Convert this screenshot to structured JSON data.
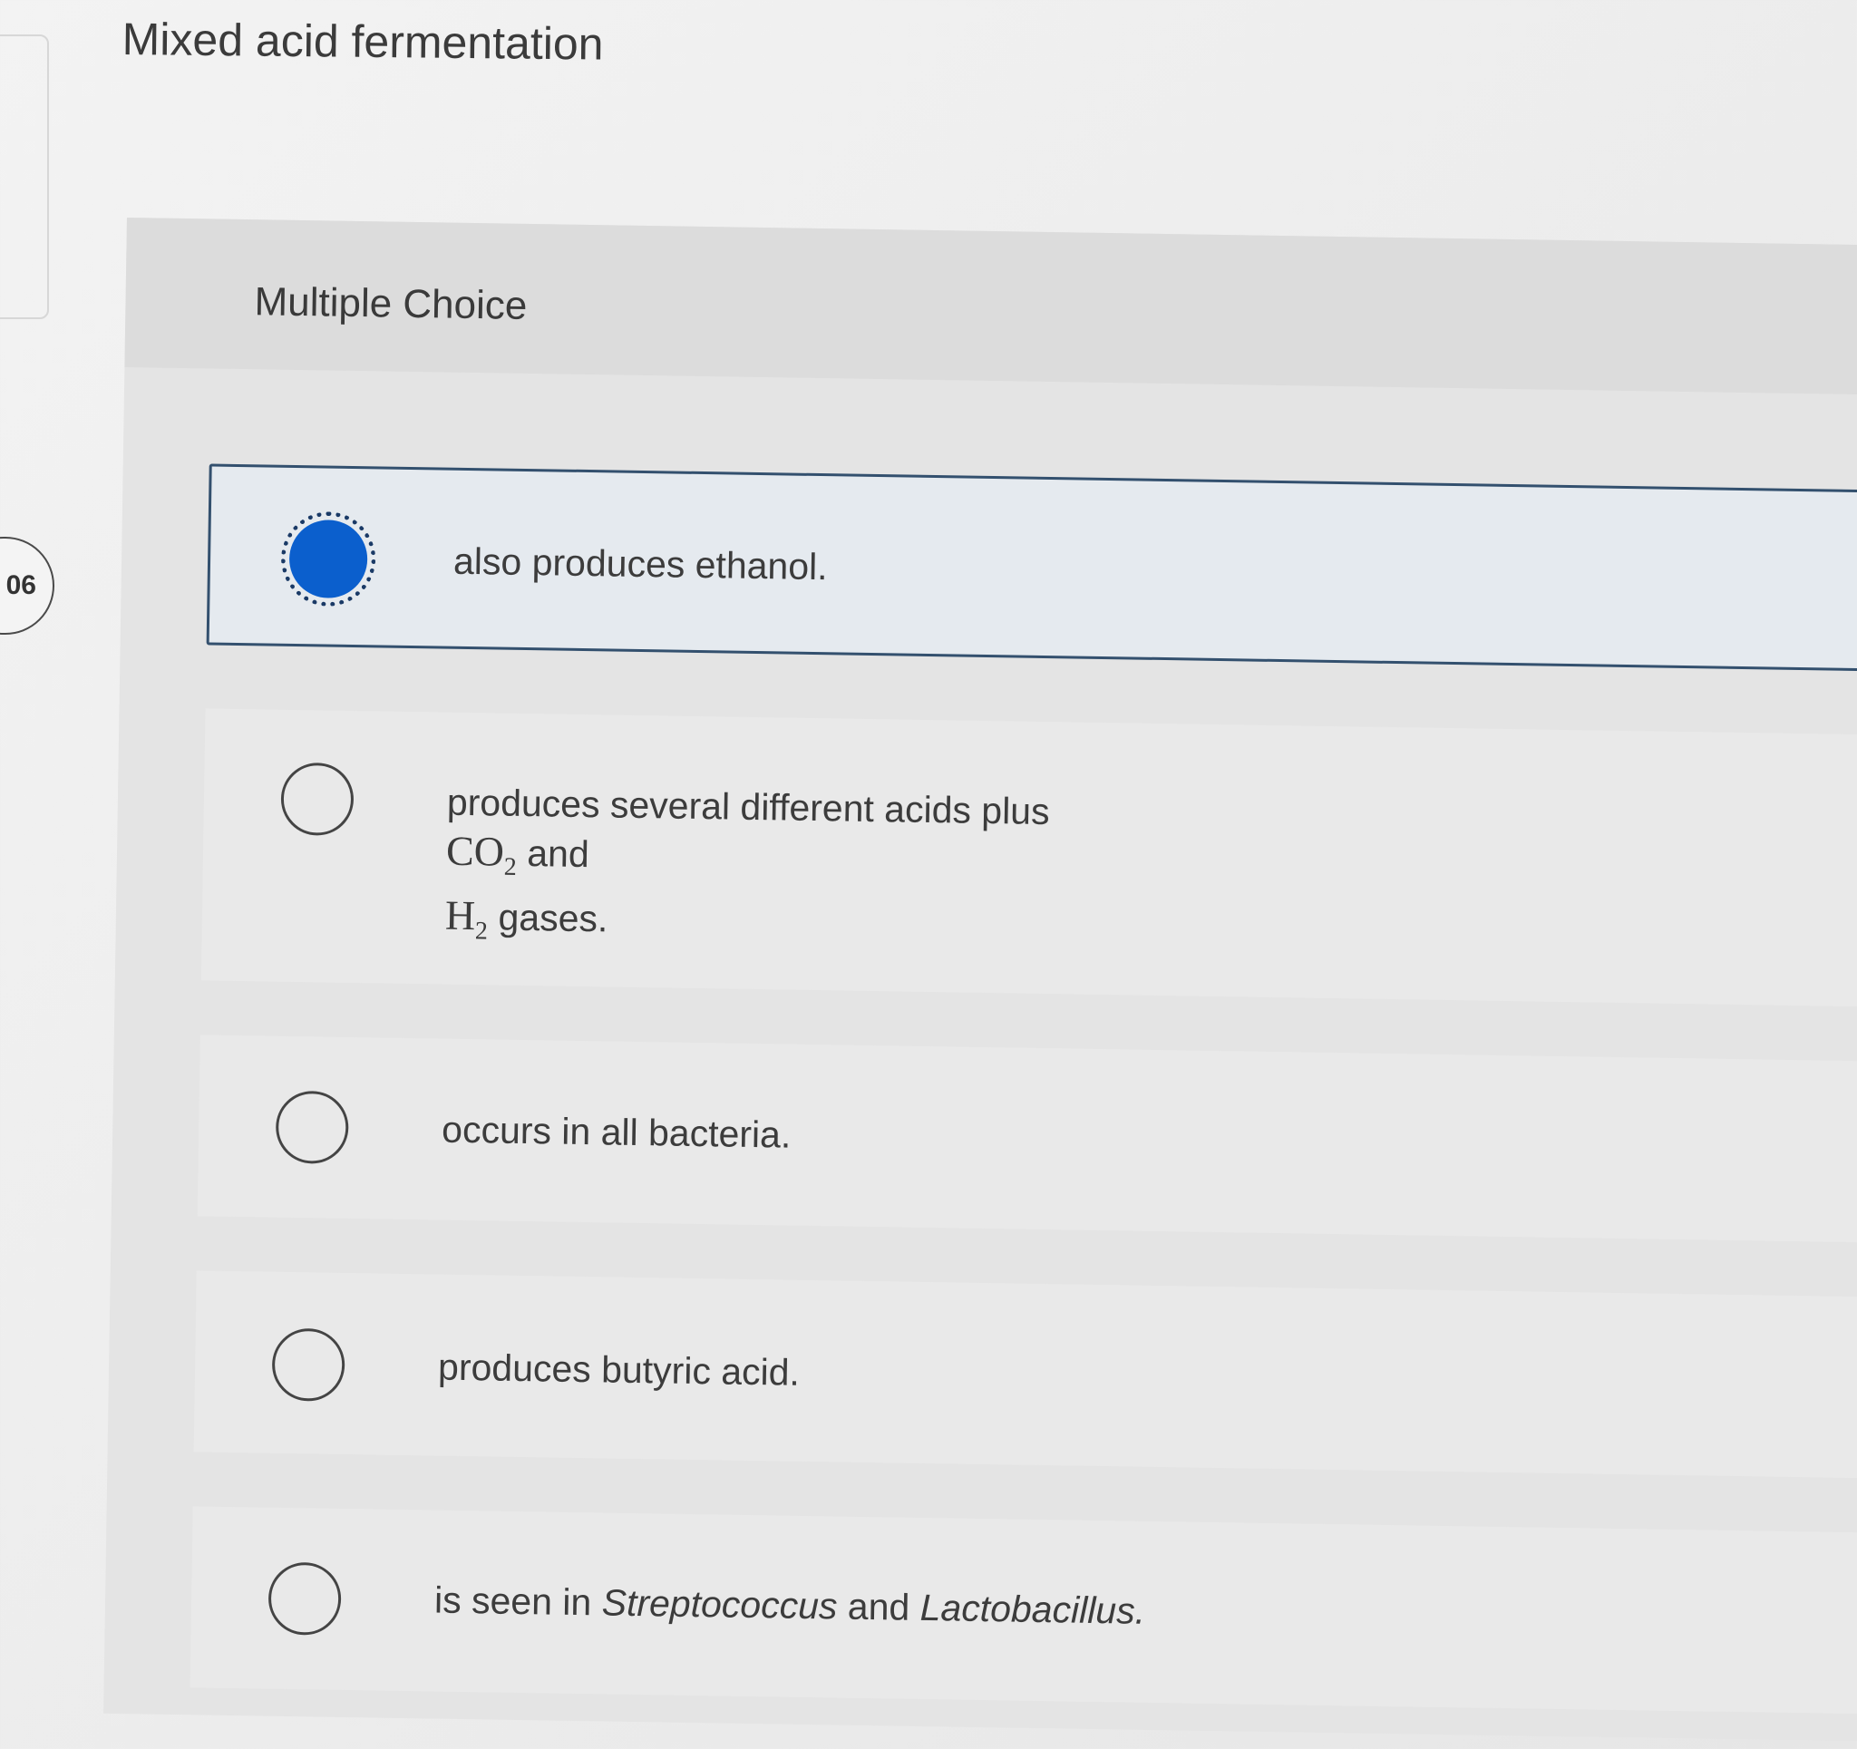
{
  "question": {
    "number": "06",
    "title": "Mixed acid fermentation",
    "type_label": "Multiple Choice"
  },
  "choices": [
    {
      "text": "also produces ethanol.",
      "selected": true
    },
    {
      "line1": "produces several different acids plus",
      "co2": "CO",
      "co2_sub": "2",
      "and": "and",
      "h2": "H",
      "h2_sub": "2",
      "gases": "gases.",
      "selected": false
    },
    {
      "text": "occurs in all bacteria.",
      "selected": false
    },
    {
      "text": "produces butyric acid.",
      "selected": false
    },
    {
      "prefix": "is seen in",
      "genus1": "Streptococcus",
      "and": "and",
      "genus2": "Lactobacillus.",
      "selected": false
    }
  ],
  "colors": {
    "selected_fill": "#0b5fcd",
    "selected_border": "#33506e"
  }
}
